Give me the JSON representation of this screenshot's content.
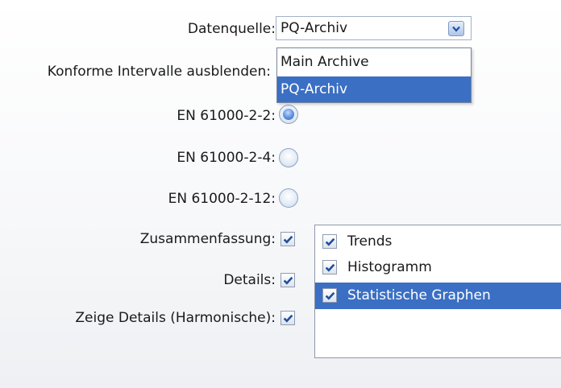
{
  "form": {
    "datasource": {
      "label": "Datenquelle:",
      "value": "PQ-Archiv",
      "options": [
        "Main Archive",
        "PQ-Archiv"
      ],
      "selected_index": 1
    },
    "hide_conforming": {
      "label": "Konforme Intervalle ausblenden:"
    },
    "standards": [
      {
        "label": "EN 61000-2-2:",
        "selected": true
      },
      {
        "label": "EN 61000-2-4:",
        "selected": false
      },
      {
        "label": "EN 61000-2-12:",
        "selected": false
      }
    ],
    "summary": {
      "label": "Zusammenfassung:",
      "checked": true
    },
    "details": {
      "label": "Details:",
      "checked": true
    },
    "harmonic_details": {
      "label": "Zeige Details (Harmonische):",
      "checked": true
    },
    "summary_items": [
      {
        "label": "Trends",
        "checked": true,
        "selected": false
      },
      {
        "label": "Histogramm",
        "checked": true,
        "selected": false
      },
      {
        "label": "Statistische Graphen",
        "checked": true,
        "selected": true
      }
    ]
  },
  "colors": {
    "selection": "#3a6fc4",
    "radio_on": "#5b8fdd",
    "checkmark": "#1f4f9e"
  },
  "icons": {
    "checkbox": "checkmark-icon",
    "dropdown": "chevron-down-icon"
  }
}
